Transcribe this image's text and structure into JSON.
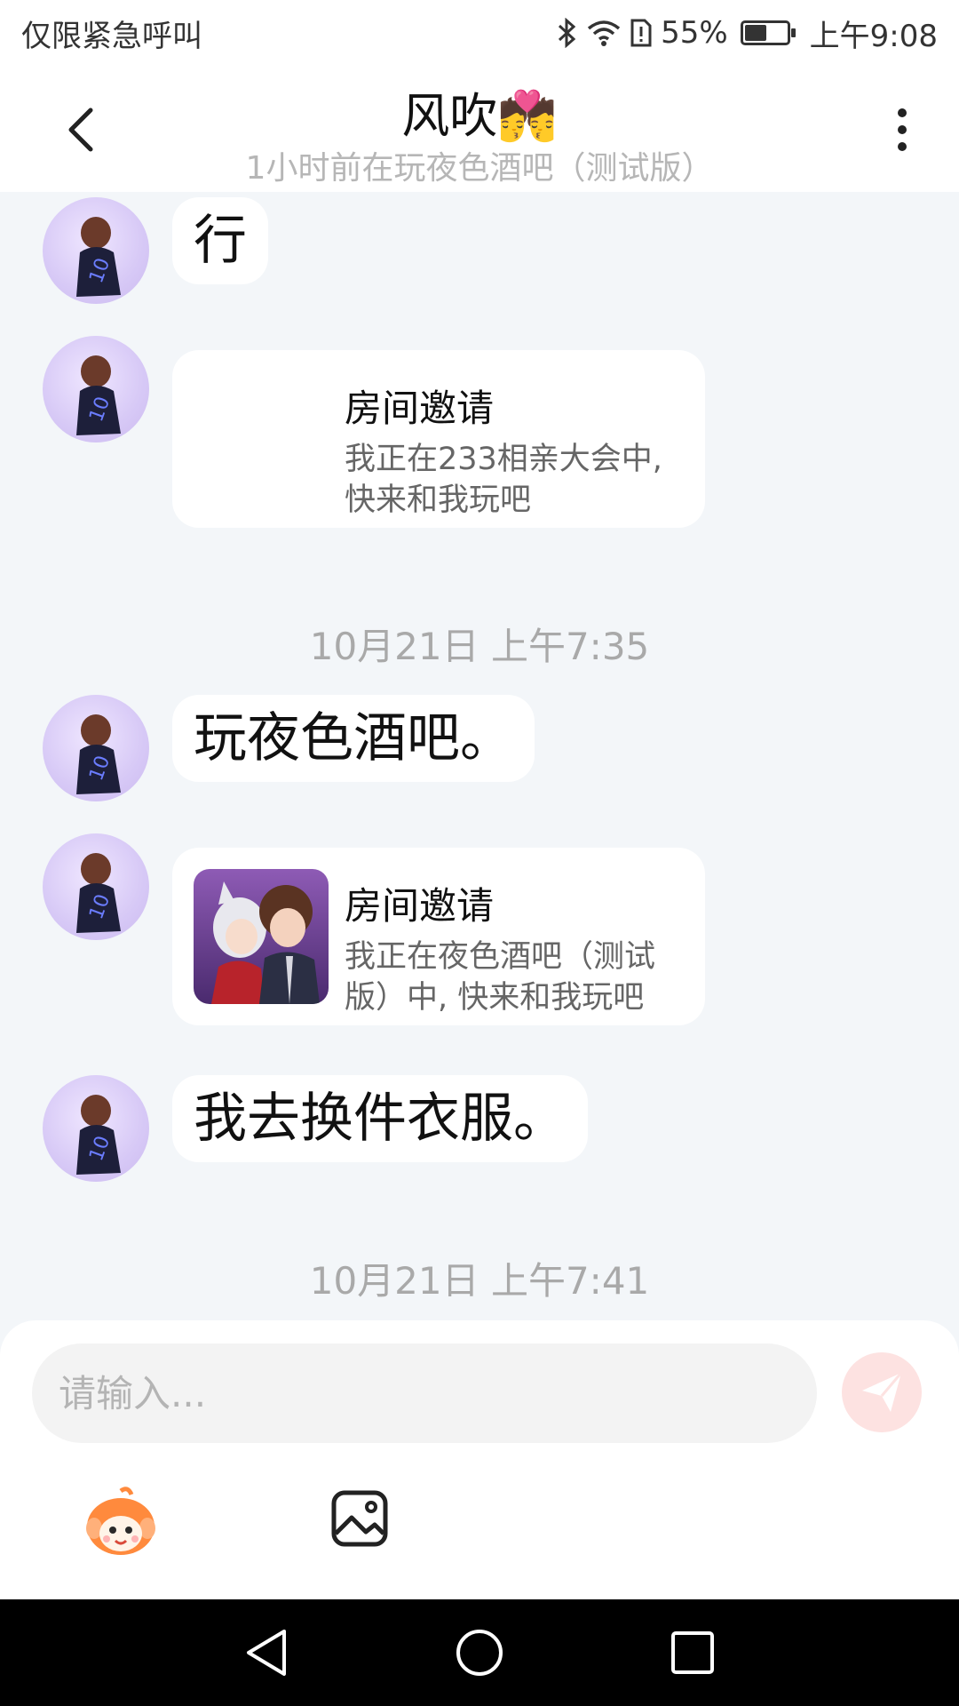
{
  "status": {
    "carrier_text": "仅限紧急呼叫",
    "battery_percent": "55%",
    "battery_level": 0.55,
    "time": "上午9:08",
    "icons": [
      "bluetooth-icon",
      "wifi-icon",
      "sim-alert-icon",
      "battery-icon"
    ]
  },
  "header": {
    "title": "风吹💏",
    "subtitle": "1小时前在玩夜色酒吧（测试版）"
  },
  "messages": {
    "m1": {
      "text": "行"
    },
    "m2": {
      "title": "房间邀请",
      "desc": "我正在233相亲大会中,快来和我玩吧"
    },
    "ts1": "10月21日 上午7:35",
    "m3": {
      "text": "玩夜色酒吧。"
    },
    "m4": {
      "title": "房间邀请",
      "desc": "我正在夜色酒吧（测试版）中, 快来和我玩吧"
    },
    "m5": {
      "text": "我去换件衣服。"
    },
    "ts2": "10月21日 上午7:41"
  },
  "input": {
    "placeholder": "请输入..."
  },
  "colors": {
    "background": "#f3f6f9",
    "send_button": "#fde2e1",
    "avatar_bg": "#d7c9f6"
  }
}
